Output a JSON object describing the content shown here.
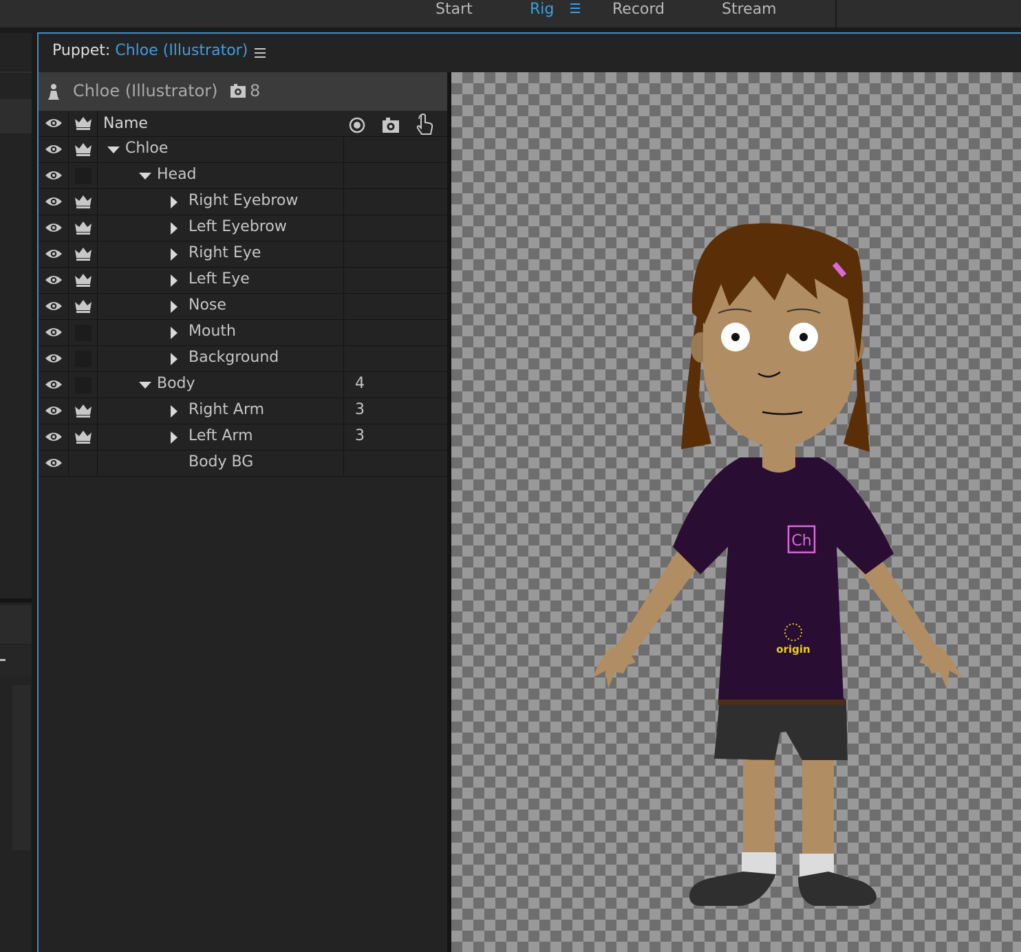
{
  "workspaces": {
    "start": "Start",
    "rig": "Rig",
    "record": "Record",
    "stream": "Stream",
    "active": "Rig"
  },
  "panel": {
    "title_prefix": "Puppet: ",
    "title_name": "Chloe (Illustrator)"
  },
  "puppet": {
    "name": "Chloe (Illustrator)",
    "count": "8"
  },
  "columns": {
    "name": "Name"
  },
  "layers": [
    {
      "name": "Chloe",
      "depth": 0,
      "expander": "expanded",
      "crown": true,
      "count": ""
    },
    {
      "name": "Head",
      "depth": 1,
      "expander": "expanded",
      "crown": false,
      "count": ""
    },
    {
      "name": "Right Eyebrow",
      "depth": 2,
      "expander": "collapsed",
      "crown": true,
      "count": ""
    },
    {
      "name": "Left Eyebrow",
      "depth": 2,
      "expander": "collapsed",
      "crown": true,
      "count": ""
    },
    {
      "name": "Right Eye",
      "depth": 2,
      "expander": "collapsed",
      "crown": true,
      "count": ""
    },
    {
      "name": "Left Eye",
      "depth": 2,
      "expander": "collapsed",
      "crown": true,
      "count": ""
    },
    {
      "name": "Nose",
      "depth": 2,
      "expander": "collapsed",
      "crown": true,
      "count": ""
    },
    {
      "name": "Mouth",
      "depth": 2,
      "expander": "collapsed",
      "crown": false,
      "count": ""
    },
    {
      "name": "Background",
      "depth": 2,
      "expander": "collapsed",
      "crown": false,
      "count": ""
    },
    {
      "name": "Body",
      "depth": 1,
      "expander": "expanded",
      "crown": false,
      "count": "4"
    },
    {
      "name": "Right Arm",
      "depth": 2,
      "expander": "collapsed",
      "crown": true,
      "count": "3"
    },
    {
      "name": "Left Arm",
      "depth": 2,
      "expander": "collapsed",
      "crown": true,
      "count": "3"
    },
    {
      "name": "Body BG",
      "depth": 2,
      "expander": "none",
      "crown": "blank",
      "count": ""
    }
  ],
  "canvas": {
    "shirt_logo": "Ch",
    "origin_label": "origin"
  },
  "colors": {
    "accent": "#3a9fe2",
    "hair": "#5a2f08",
    "skin": "#b08d62",
    "shirt": "#2a0d33",
    "shorts": "#2f2f2f",
    "logo": "#d86bd8",
    "origin": "#e8d21a"
  }
}
